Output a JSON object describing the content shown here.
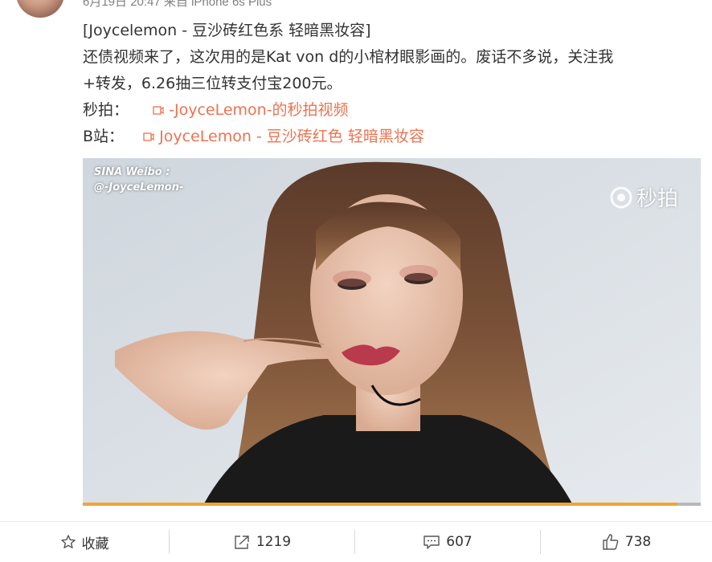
{
  "post": {
    "meta_text": "6月19日 20:47 来自 iPhone 6s Plus",
    "title_line": "[Joycelemon - 豆沙砖红色系 轻暗黑妆容]",
    "body_line1": "还债视频来了，这次用的是Kat von d的小棺材眼影画的。废话不多说，关注我",
    "body_line2": "+转发，6.26抽三位转支付宝200元。",
    "miaopai_label": "秒拍：",
    "miaopai_link": "-JoyceLemon-的秒拍视频",
    "bilibili_label": "B站：",
    "bilibili_link": "JoyceLemon - 豆沙砖红色 轻暗黑妆容"
  },
  "video": {
    "watermark_line1": "SINA Weibo :",
    "watermark_line2": "@-JoyceLemon-",
    "brand_text": "秒拍",
    "progress": 0.962
  },
  "toolbar": {
    "favorite_label": "收藏",
    "repost_count": "1219",
    "comment_count": "607",
    "like_count": "738"
  },
  "colors": {
    "link": "#eb7350",
    "progress": "#f0a534",
    "text": "#333333",
    "meta": "#808080"
  }
}
